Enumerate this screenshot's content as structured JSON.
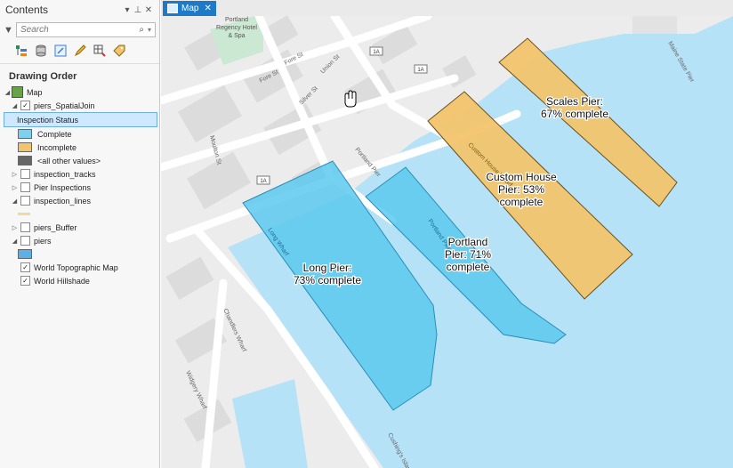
{
  "contents": {
    "title": "Contents",
    "search_placeholder": "Search",
    "drawing_order_heading": "Drawing Order",
    "tree": [
      {
        "label": "Map",
        "checked": null,
        "expander": "◢"
      },
      {
        "label": "piers_SpatialJoin",
        "checked": true,
        "expander": "◢"
      },
      {
        "label": "Inspection Status",
        "selected": true
      },
      {
        "label": "Complete",
        "swatch": "#7fd0ee"
      },
      {
        "label": "Incomplete",
        "swatch": "#f2c46b"
      },
      {
        "label": "<all other values>",
        "swatch": "#666666"
      },
      {
        "label": "inspection_tracks",
        "checked": false,
        "expander": "▷"
      },
      {
        "label": "Pier Inspections",
        "checked": false,
        "expander": "▷"
      },
      {
        "label": "inspection_lines",
        "checked": false,
        "expander": "◢"
      },
      {
        "label": "piers_Buffer",
        "checked": false,
        "expander": "▷"
      },
      {
        "label": "piers",
        "checked": false,
        "expander": "◢"
      },
      {
        "label": "World Topographic Map",
        "checked": true
      },
      {
        "label": "World Hillshade",
        "checked": true
      }
    ]
  },
  "map_tab": {
    "label": "Map",
    "close": "✕"
  },
  "colors": {
    "water": "#b6e2f7",
    "land": "#ececec",
    "road": "#ffffff",
    "complete": "#5cc9ee",
    "incomplete": "#f2c46b",
    "accent": "#1e7ac9"
  },
  "map": {
    "piers": [
      {
        "label_lines": [
          "Long Pier:",
          "73% complete"
        ],
        "status": "complete",
        "inner_label": "Long Wharf"
      },
      {
        "label_lines": [
          "Portland",
          "Pier: 71%",
          "complete"
        ],
        "status": "complete",
        "inner_label": "Portland Pier"
      },
      {
        "label_lines": [
          "Custom House",
          "Pier: 53%",
          "complete"
        ],
        "status": "incomplete",
        "inner_label": "Custom House Wharf"
      },
      {
        "label_lines": [
          "Scales Pier:",
          "67% complete"
        ],
        "status": "incomplete",
        "inner_label": ""
      }
    ],
    "street_labels": [
      "Fore St",
      "Fore St",
      "Union St",
      "Silver St",
      "Portland Pier",
      "Moulton St",
      "Chandlers Wharf",
      "Widgery Wharf",
      "Maine State Pier",
      "Cushing's Island"
    ],
    "poi_label_lines": [
      "Portland",
      "Regency Hotel",
      "& Spa"
    ],
    "route_shields": [
      "1A",
      "1A",
      "1A"
    ]
  }
}
